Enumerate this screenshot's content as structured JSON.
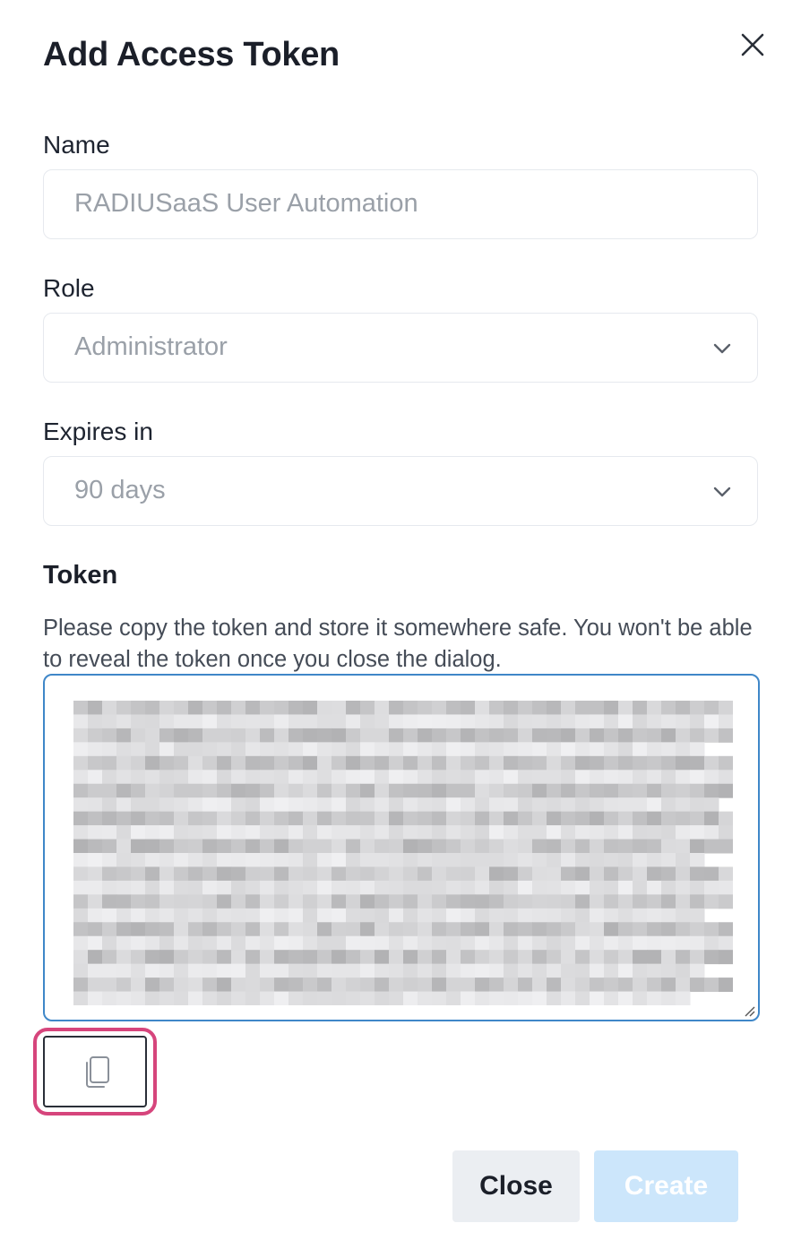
{
  "dialog": {
    "title": "Add Access Token",
    "close_icon": "close-x-icon"
  },
  "form": {
    "name": {
      "label": "Name",
      "value": "RADIUSaaS User Automation"
    },
    "role": {
      "label": "Role",
      "selected": "Administrator",
      "icon": "chevron-down-icon"
    },
    "expires": {
      "label": "Expires in",
      "selected": "90 days",
      "icon": "chevron-down-icon"
    }
  },
  "token": {
    "heading": "Token",
    "help": "Please copy the token and store it somewhere safe. You won't be able to reveal the token once you close the dialog.",
    "value_redacted": true,
    "copy_icon": "copy-icon"
  },
  "footer": {
    "close_label": "Close",
    "create_label": "Create"
  },
  "colors": {
    "focus_border": "#3f87c8",
    "highlight": "#d6457c",
    "create_disabled_bg": "#cce6fb",
    "close_bg": "#ebeef2"
  }
}
